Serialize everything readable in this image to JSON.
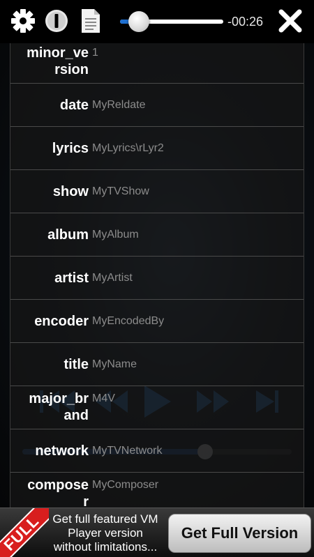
{
  "toolbar": {
    "settings_icon": "gear-icon",
    "info_icon": "info-icon",
    "document_icon": "document-icon",
    "close_icon": "close-icon",
    "seek_progress": 0.15,
    "time_remaining": "-00:26"
  },
  "metadata": {
    "rows": [
      {
        "key_lines": [
          "minor_ve",
          "rsion"
        ],
        "value": "1"
      },
      {
        "key_lines": [
          "date"
        ],
        "value": "MyReldate"
      },
      {
        "key_lines": [
          "lyrics"
        ],
        "value": "MyLyrics\\rLyr2"
      },
      {
        "key_lines": [
          "show"
        ],
        "value": "MyTVShow"
      },
      {
        "key_lines": [
          "album"
        ],
        "value": "MyAlbum"
      },
      {
        "key_lines": [
          "artist"
        ],
        "value": "MyArtist"
      },
      {
        "key_lines": [
          "encoder"
        ],
        "value": "MyEncodedBy"
      },
      {
        "key_lines": [
          "title"
        ],
        "value": "MyName"
      },
      {
        "key_lines": [
          "major_br",
          "and"
        ],
        "value": "M4V"
      },
      {
        "key_lines": [
          "network"
        ],
        "value": "MyTVNetwork"
      },
      {
        "key_lines": [
          "compose",
          "r"
        ],
        "value": "MyComposer"
      }
    ]
  },
  "player": {
    "volume_level": 0.68
  },
  "banner": {
    "badge": "FULL",
    "line1": "Get full featured VM",
    "line2": "Player version",
    "line3": "without limitations...",
    "button_label": "Get Full Version"
  },
  "colors": {
    "accent": "#1e6fd0",
    "badge_red": "#d81e1e"
  }
}
